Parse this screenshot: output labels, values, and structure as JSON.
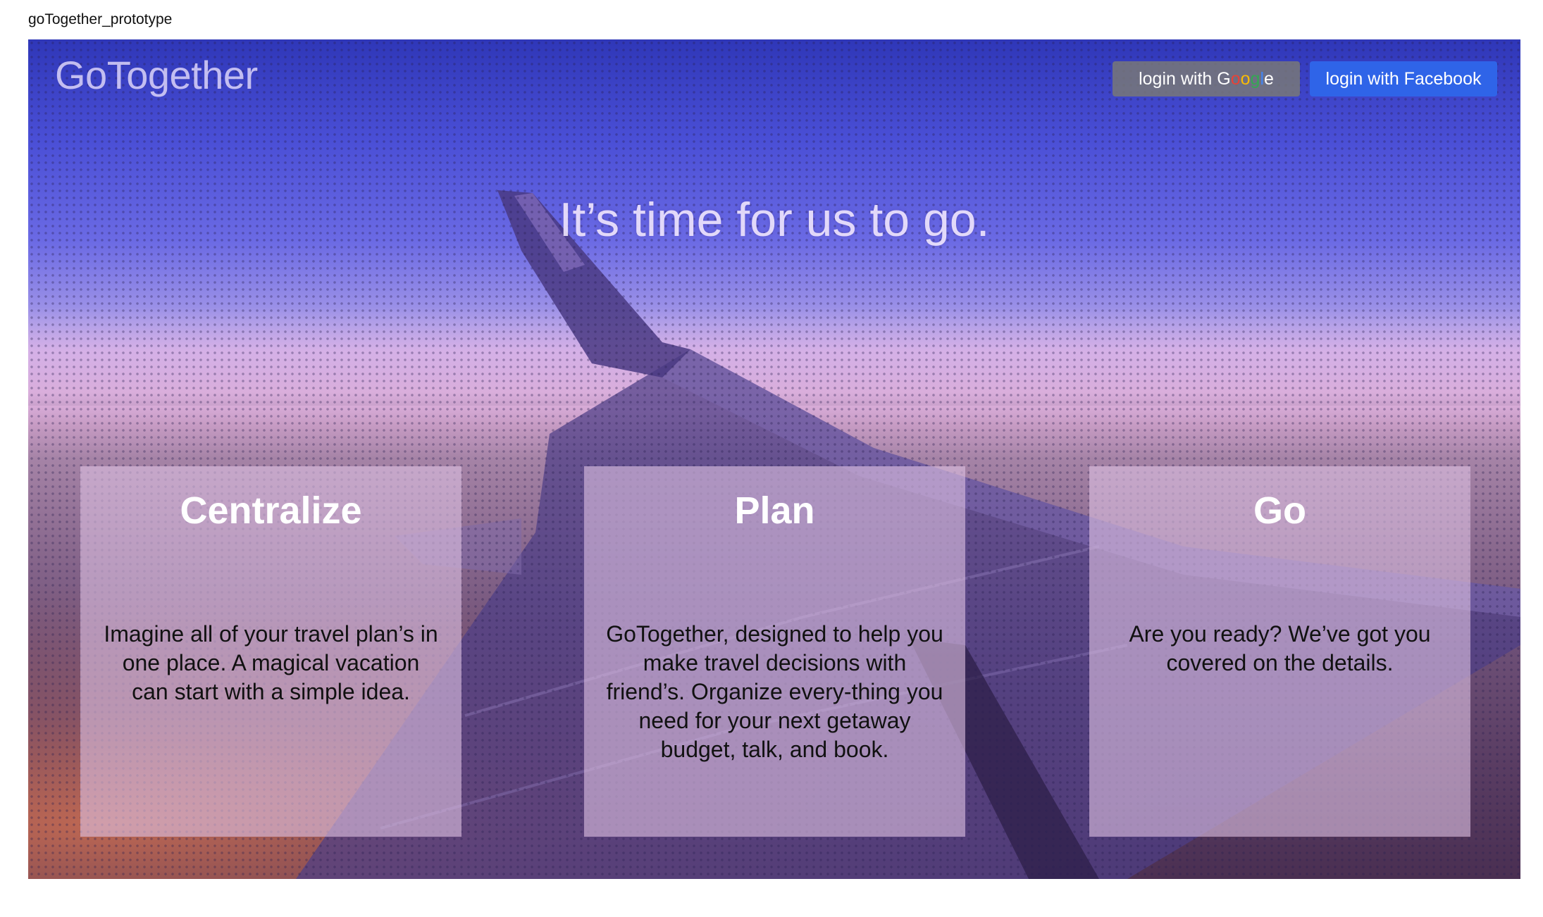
{
  "window": {
    "title": "goTogether_prototype"
  },
  "header": {
    "logo": "GoTogether",
    "google_button": {
      "prefix": "login with G",
      "letters": [
        {
          "char": "o",
          "color": "#e94235"
        },
        {
          "char": "o",
          "color": "#fabb05"
        },
        {
          "char": "g",
          "color": "#34a853"
        },
        {
          "char": "l",
          "color": "#4285f4"
        }
      ],
      "suffix": "e"
    },
    "facebook_button_label": "login with Facebook"
  },
  "hero": {
    "tagline": "It’s time for us to go."
  },
  "cards": [
    {
      "title": "Centralize",
      "body": "Imagine all of your travel plan’s in one place. A magical vacation can start with a simple idea."
    },
    {
      "title": "Plan",
      "body": "GoTogether, designed to help you make travel decisions with friend’s. Organize every-thing you need for your next getaway budget, talk, and book."
    },
    {
      "title": "Go",
      "body": "Are you ready? We’ve got you covered on the details."
    }
  ],
  "colors": {
    "facebook_blue": "#2f64e8",
    "google_button_gray": "#787878",
    "card_overlay": "#dcbee1"
  },
  "icons": {
    "hero_image": "airplane-wing-sunset-image"
  }
}
